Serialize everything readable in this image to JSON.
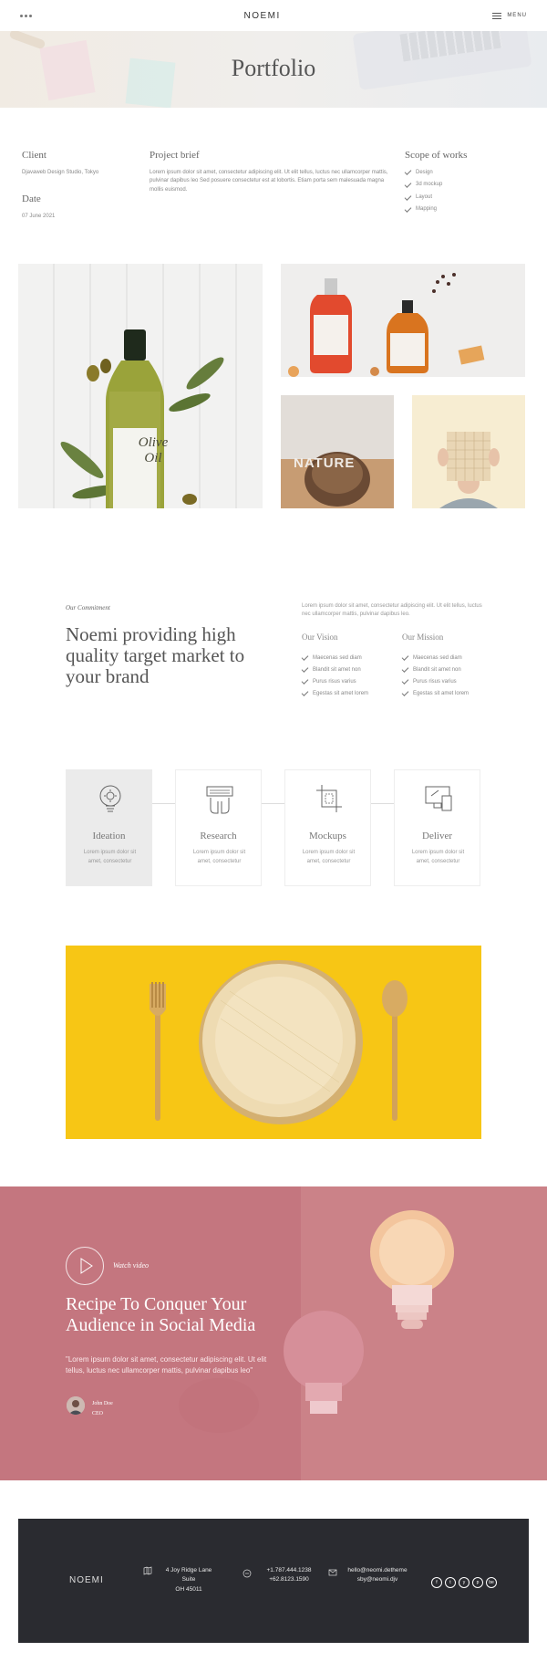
{
  "header": {
    "brand": "NOEMI",
    "menu_label": "MENU"
  },
  "hero": {
    "title": "Portfolio"
  },
  "meta": {
    "client_label": "Client",
    "client_value": "Djavaweb Design Studio, Tokyo",
    "date_label": "Date",
    "date_value": "07 June 2021",
    "brief_label": "Project brief",
    "brief_text": "Lorem ipsum dolor sit amet, consectetur adipiscing elit. Ut elit tellus, luctus nec ullamcorper mattis, pulvinar dapibus leo Sed posuere consectetur est at lobortis. Etiam porta sem malesuada magna mollis euismod.",
    "scope_label": "Scope of works",
    "scope_items": [
      "Design",
      "3d mockup",
      "Layout",
      "Mapping"
    ]
  },
  "gallery": {
    "olive_label_1": "Olive",
    "olive_label_2": "Oil",
    "pinecone_word": "NATURE"
  },
  "commitment": {
    "kicker": "Our Commitment",
    "title": "Noemi providing high quality target market to your brand",
    "text": "Lorem ipsum dolor sit amet, consectetur adipiscing elit. Ut elit tellus, luctus nec ullamcorper mattis, pulvinar dapibus leo.",
    "vision_title": "Our Vision",
    "vision_items": [
      "Maecenas sed diam",
      "Blandit sit amet non",
      "Purus risus varius",
      "Egestas sit amet lorem"
    ],
    "mission_title": "Our Mission",
    "mission_items": [
      "Maecenas sed diam",
      "Blandit sit amet non",
      "Purus risus varius",
      "Egestas sit amet lorem"
    ]
  },
  "process": [
    {
      "title": "Ideation",
      "text": "Lorem ipsum dolor sit amet, consectetur",
      "icon": "lightbulb-gear-icon"
    },
    {
      "title": "Research",
      "text": "Lorem ipsum dolor sit amet, consectetur",
      "icon": "hands-keyboard-icon"
    },
    {
      "title": "Mockups",
      "text": "Lorem ipsum dolor sit amet, consectetur",
      "icon": "crop-frame-icon"
    },
    {
      "title": "Deliver",
      "text": "Lorem ipsum dolor sit amet, consectetur",
      "icon": "devices-icon"
    }
  ],
  "video": {
    "watch_label": "Watch video",
    "title": "Recipe To Conquer Your Audience in Social Media",
    "quote": "\"Lorem ipsum dolor sit amet, consectetur adipiscing elit. Ut elit tellus, luctus nec ullamcorper mattis, pulvinar dapibus leo\"",
    "person_name": "John Doe",
    "person_role": "CEO"
  },
  "footer": {
    "brand": "NOEMI",
    "address_1": "4 Joy Ridge Lane",
    "address_2": "Suite",
    "address_3": "OH 45011",
    "phone_1": "+1.787.444.1238",
    "phone_2": "+62.8123.1590",
    "email_1": "hello@neomi.detheme",
    "email_2": "sby@neomi.djv",
    "socials": [
      "f",
      "t",
      "y",
      "p",
      "be"
    ]
  },
  "colors": {
    "accent_yellow": "#f7c615",
    "video_pink": "#c5777f",
    "footer_dark": "#2a2b30",
    "process_active": "#ebebeb"
  }
}
